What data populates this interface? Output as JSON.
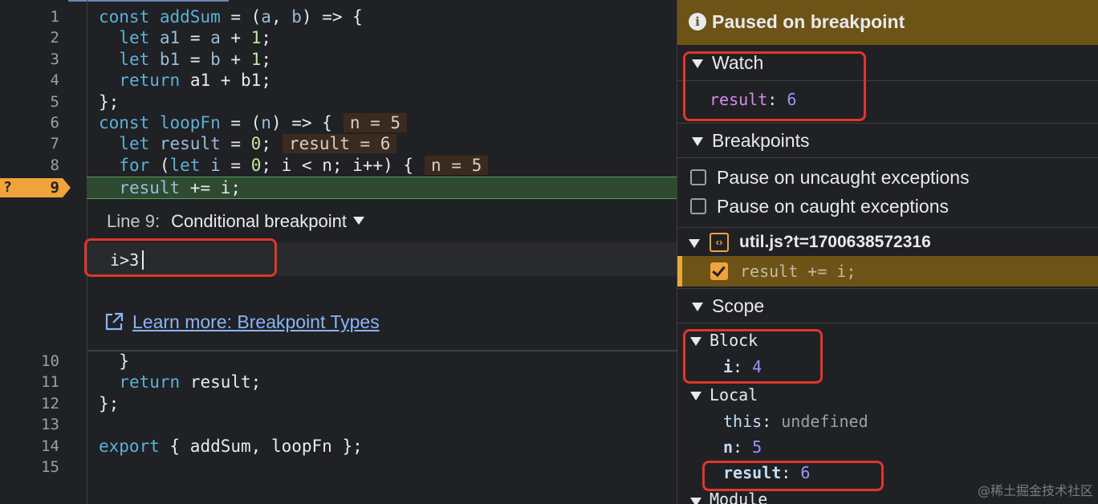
{
  "editor": {
    "lines_top": [
      {
        "n": "1",
        "code": [
          [
            "kw",
            "const "
          ],
          [
            "fn",
            "addSum"
          ],
          [
            "op",
            " = ("
          ],
          [
            "vr",
            "a"
          ],
          [
            "op",
            ", "
          ],
          [
            "vr",
            "b"
          ],
          [
            "op",
            ") => {"
          ]
        ]
      },
      {
        "n": "2",
        "code": [
          [
            "op",
            "  "
          ],
          [
            "kw",
            "let "
          ],
          [
            "vr",
            "a1"
          ],
          [
            "op",
            " = "
          ],
          [
            "vr",
            "a"
          ],
          [
            "op",
            " + "
          ],
          [
            "nm",
            "1"
          ],
          [
            "op",
            ";"
          ]
        ]
      },
      {
        "n": "3",
        "code": [
          [
            "op",
            "  "
          ],
          [
            "kw",
            "let "
          ],
          [
            "vr",
            "b1"
          ],
          [
            "op",
            " = "
          ],
          [
            "vr",
            "b"
          ],
          [
            "op",
            " + "
          ],
          [
            "nm",
            "1"
          ],
          [
            "op",
            ";"
          ]
        ]
      },
      {
        "n": "4",
        "code": [
          [
            "op",
            "  "
          ],
          [
            "kw",
            "return "
          ],
          [
            "op",
            "a1 + b1;"
          ]
        ]
      },
      {
        "n": "5",
        "code": [
          [
            "op",
            "};"
          ]
        ]
      },
      {
        "n": "6",
        "code": [
          [
            "kw",
            "const "
          ],
          [
            "fn",
            "loopFn"
          ],
          [
            "op",
            " = ("
          ],
          [
            "vr",
            "n"
          ],
          [
            "op",
            ") => {"
          ]
        ],
        "inline": "n = 5"
      },
      {
        "n": "7",
        "code": [
          [
            "op",
            "  "
          ],
          [
            "kw",
            "let "
          ],
          [
            "vr",
            "result"
          ],
          [
            "op",
            " = "
          ],
          [
            "nm",
            "0"
          ],
          [
            "op",
            ";"
          ]
        ],
        "inline": "result = 6"
      },
      {
        "n": "8",
        "code": [
          [
            "op",
            "  "
          ],
          [
            "kw",
            "for "
          ],
          [
            "op",
            "("
          ],
          [
            "kw",
            "let "
          ],
          [
            "vr",
            "i"
          ],
          [
            "op",
            " = "
          ],
          [
            "nm",
            "0"
          ],
          [
            "op",
            "; i < n; i++) {"
          ]
        ],
        "inline": "n = 5"
      }
    ],
    "line9": {
      "n": "9",
      "marker_q": "?",
      "code_hl": "result",
      "code_rest": " += i;"
    },
    "lines_bottom": [
      {
        "n": "10",
        "code": [
          [
            "op",
            "  }"
          ]
        ]
      },
      {
        "n": "11",
        "code": [
          [
            "op",
            "  "
          ],
          [
            "kw",
            "return "
          ],
          [
            "op",
            "result;"
          ]
        ]
      },
      {
        "n": "12",
        "code": [
          [
            "op",
            "};"
          ]
        ]
      },
      {
        "n": "13",
        "code": [
          [
            "op",
            ""
          ]
        ]
      },
      {
        "n": "14",
        "code": [
          [
            "kw",
            "export "
          ],
          [
            "op",
            "{ addSum, loopFn };"
          ]
        ]
      },
      {
        "n": "15",
        "code": [
          [
            "op",
            ""
          ]
        ]
      }
    ],
    "bp_editor": {
      "line_label": "Line 9:",
      "type_label": "Conditional breakpoint",
      "condition_value": "i>3",
      "learn_more": "Learn more: Breakpoint Types"
    }
  },
  "pane": {
    "paused": "Paused on breakpoint",
    "watch": {
      "title": "Watch",
      "name": "result",
      "sep": ":",
      "value": "6"
    },
    "breakpoints": {
      "title": "Breakpoints",
      "uncaught": "Pause on uncaught exceptions",
      "caught": "Pause on caught exceptions",
      "file": "util.js?t=1700638572316",
      "item_code": "result += i;"
    },
    "scope": {
      "title": "Scope",
      "block": {
        "label": "Block",
        "var": "i",
        "sep": ":",
        "value": "4"
      },
      "local": {
        "label": "Local",
        "this_name": "this",
        "this_sep": ":",
        "this_value": "undefined",
        "n_name": "n",
        "n_sep": ":",
        "n_value": "5",
        "result_name": "result",
        "result_sep": ":",
        "result_value": "6"
      },
      "module": {
        "label": "Module"
      }
    },
    "watermark": "@稀土掘金技术社区"
  },
  "colors": {
    "accent": "#8ab4f8",
    "paused": "#6d5315",
    "highlight": "#e0362b",
    "breakpoint": "#f0a33a"
  }
}
